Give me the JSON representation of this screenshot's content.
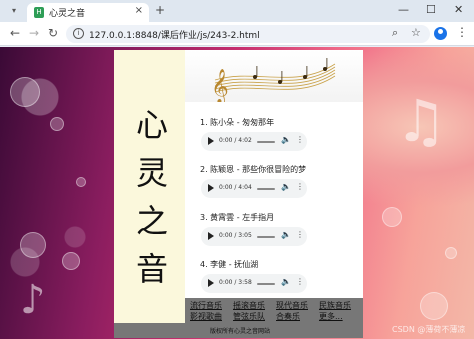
{
  "browser": {
    "tab_title": "心灵之音",
    "tab_close": "×",
    "new_tab": "+",
    "url": "127.0.0.1:8848/课后作业/js/243-2.html",
    "minimize": "—",
    "maximize": "☐",
    "close": "✕"
  },
  "page": {
    "title_chars": [
      "心",
      "灵",
      "之",
      "音"
    ],
    "songs": [
      {
        "title": "1. 陈小朵 - 匆匆那年",
        "time": "0:00 / 4:02"
      },
      {
        "title": "2. 陈颖恩 - 那些你很冒险的梦",
        "time": "0:00 / 4:04"
      },
      {
        "title": "3. 黄霄雲 - 左手指月",
        "time": "0:00 / 3:05"
      },
      {
        "title": "4. 李健 - 抚仙湖",
        "time": "0:00 / 3:58"
      }
    ],
    "nav": {
      "row1": [
        "流行音乐",
        "摇滚音乐",
        "现代音乐",
        "民族音乐"
      ],
      "row2": [
        "影视歌曲",
        "管弦乐队",
        "合奏乐",
        "更多..."
      ]
    },
    "footer": "版权所有心灵之音网站",
    "watermark": "CSDN @薄荷不薄凉"
  },
  "colors": {
    "accent": "#1a73e8",
    "title_bg": "#fbf8dc",
    "nav_bg": "#777777"
  }
}
